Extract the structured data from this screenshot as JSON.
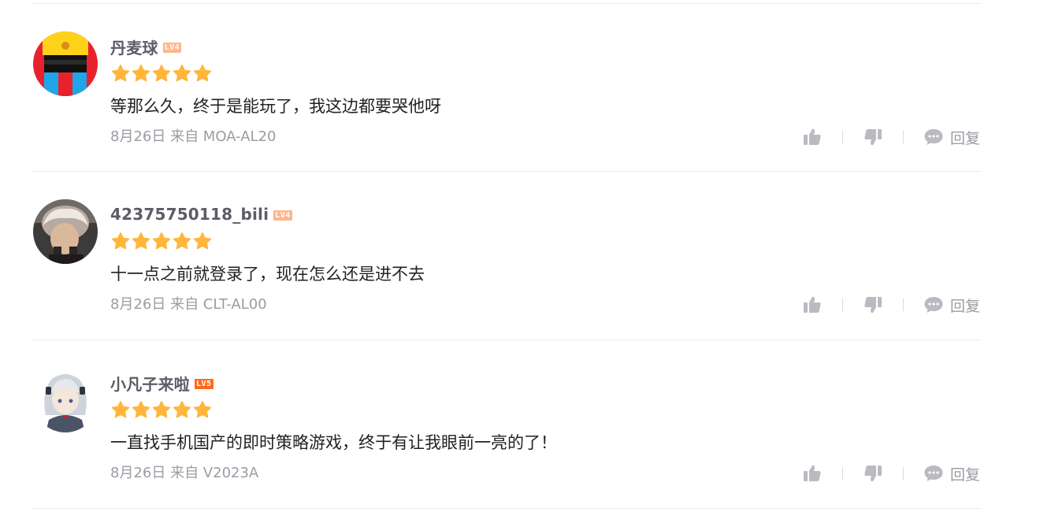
{
  "colors": {
    "star": "#ffb63a",
    "username": "#5a5d66",
    "meta": "#9a9ca3",
    "icon": "#b9bbc1",
    "divider": "#e9e9ec",
    "level_lv4": "#ffb68a",
    "level_lv5": "#ff6a1a"
  },
  "comments": [
    {
      "username": "丹麦球",
      "level": "LV4",
      "rating": 5,
      "content": "等那么久，终于是能玩了，我这边都要哭他呀",
      "meta": "8月26日 来自 MOA-AL20",
      "reply_label": "回复"
    },
    {
      "username": "42375750118_bili",
      "level": "LV4",
      "rating": 5,
      "content": "十一点之前就登录了，现在怎么还是进不去",
      "meta": "8月26日 来自 CLT-AL00",
      "reply_label": "回复"
    },
    {
      "username": "小凡子来啦",
      "level": "LV5",
      "rating": 5,
      "content": "一直找手机国产的即时策略游戏，终于有让我眼前一亮的了！",
      "meta": "8月26日 来自 V2023A",
      "reply_label": "回复"
    }
  ]
}
